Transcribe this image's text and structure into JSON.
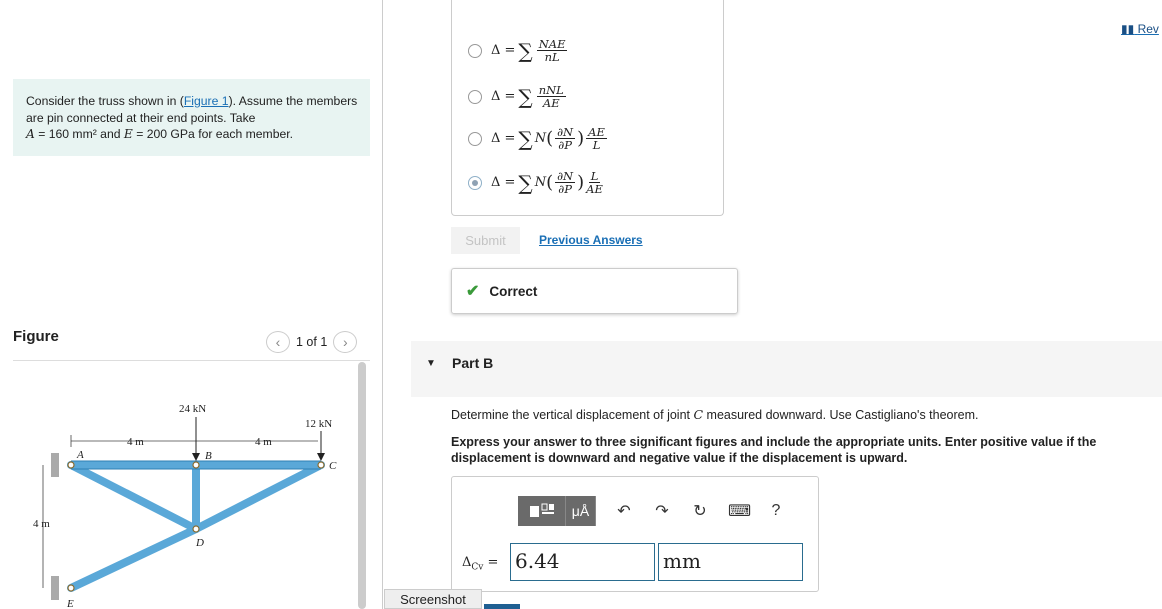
{
  "problem": {
    "text_1": "Consider the truss shown in (",
    "figure_link": "Figure 1",
    "text_2": "). Assume the members are pin connected at their end points. Take",
    "text_3": " = 160 mm² and ",
    "text_4": " = 200 GPa for each member.",
    "var_a": "A",
    "var_e": "E"
  },
  "figure": {
    "title": "Figure",
    "pager": "1 of 1",
    "labels": {
      "load_b": "24 kN",
      "load_c": "12 kN",
      "dim_ab": "4 m",
      "dim_bc": "4 m",
      "dim_ae": "4 m",
      "joint_a": "A",
      "joint_b": "B",
      "joint_c": "C",
      "joint_d": "D",
      "joint_e": "E"
    }
  },
  "choices": {
    "prefix": "Δ = ",
    "c1": {
      "num": "NAE",
      "den": "nL"
    },
    "c2": {
      "num": "nNL",
      "den": "AE"
    },
    "c3": {
      "pre": "N",
      "pnum": "∂N",
      "pden": "∂P",
      "num": "AE",
      "den": "L"
    },
    "c4": {
      "pre": "N",
      "pnum": "∂N",
      "pden": "∂P",
      "num": "L",
      "den": "AE"
    },
    "selected": 4
  },
  "actions": {
    "submit": "Submit",
    "previous_answers": "Previous Answers",
    "correct": "Correct"
  },
  "part_b": {
    "title": "Part B",
    "question_1": "Determine the vertical displacement of joint ",
    "question_joint": "C",
    "question_2": " measured downward. Use Castigliano's theorem.",
    "instructions": "Express your answer to three significant figures and include the appropriate units. Enter positive value if the displacement is downward and negative value if the displacement is upward.",
    "answer_label": "Δ",
    "answer_sub": "Cv",
    "answer_eq": " =",
    "answer_value": "6.44",
    "unit_value": "mm",
    "toolbar": {
      "mu_a": "μÅ",
      "help": "?"
    }
  },
  "header": {
    "review": "Rev"
  },
  "footer": {
    "screenshot": "Screenshot"
  }
}
